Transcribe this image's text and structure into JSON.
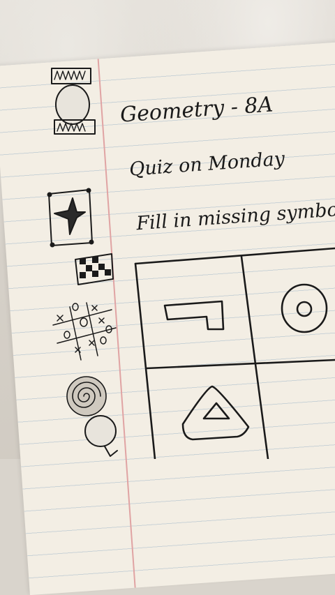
{
  "notes": {
    "title": "Geometry - 8A",
    "line2": "Quiz on Monday",
    "line3": "Fill in missing symbol"
  },
  "colors": {
    "ink": "#1a1a1a",
    "paper": "#f3eee4",
    "rule": "#c9d2d6",
    "margin": "#e0a3a3"
  },
  "doodles": [
    "capital-column",
    "star-in-square",
    "checkerboard",
    "tic-tac-toe",
    "spiral-circle",
    "circle-face"
  ],
  "grid_symbols": [
    "l-shape",
    "circle-in-circle",
    "triangle-in-triangle",
    "empty"
  ]
}
